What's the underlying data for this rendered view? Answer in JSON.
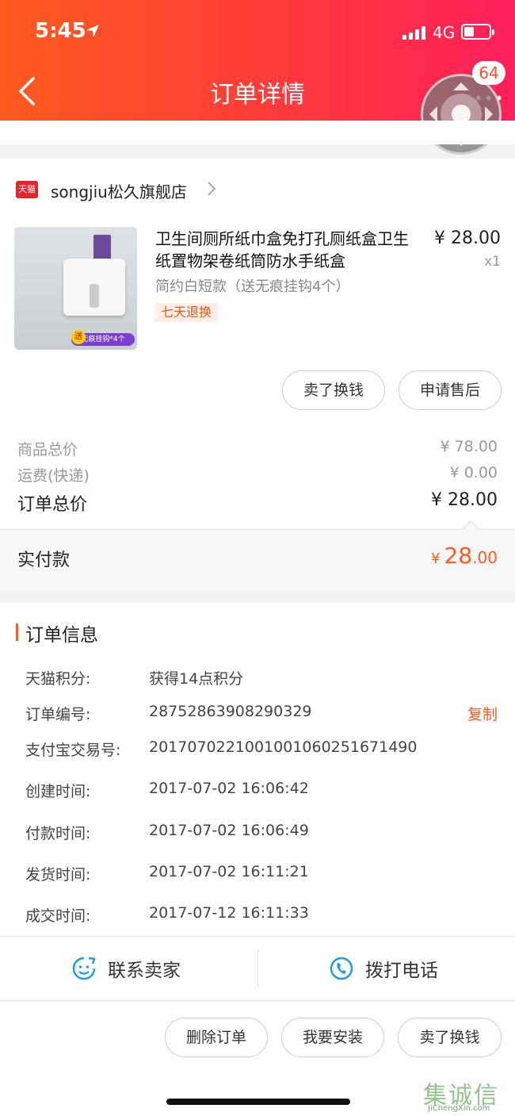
{
  "status_bar": {
    "time": "5:45",
    "network": "4G"
  },
  "header": {
    "title": "订单详情",
    "badge_count": "64"
  },
  "store": {
    "logo_text": "天猫",
    "name": "songjiu松久旗舰店"
  },
  "product": {
    "title": "卫生间厕所纸巾盒免打孔厕纸盒卫生纸置物架卷纸筒防水手纸盒",
    "variant": "简约白短款（送无痕挂钩4个）",
    "tag": "七天退换",
    "price": "¥ 28.00",
    "quantity": "x1",
    "image_send": "送",
    "image_tag": "无痕挂钩*4个"
  },
  "item_actions": {
    "sell": "卖了换钱",
    "after_sale": "申请售后"
  },
  "summary": {
    "goods_label": "商品总价",
    "goods_value": "¥ 78.00",
    "shipping_label": "运费(快递)",
    "shipping_value": "¥ 0.00",
    "total_label": "订单总价",
    "total_value": "¥ 28.00"
  },
  "paid": {
    "label": "实付款",
    "currency": "¥",
    "integer": "28",
    "decimal": ".00"
  },
  "order_info": {
    "title": "订单信息",
    "copy": "复制",
    "rows": [
      {
        "label": "天猫积分:",
        "value": "获得14点积分"
      },
      {
        "label": "订单编号:",
        "value": "28752863908290329"
      },
      {
        "label": "支付宝交易号:",
        "value": "2017070221001001060251671490"
      },
      {
        "label": "创建时间:",
        "value": "2017-07-02 16:06:42"
      },
      {
        "label": "付款时间:",
        "value": "2017-07-02 16:06:49"
      },
      {
        "label": "发货时间:",
        "value": "2017-07-02 16:11:21"
      },
      {
        "label": "成交时间:",
        "value": "2017-07-12 16:11:33"
      }
    ]
  },
  "contact": {
    "seller": "联系卖家",
    "call": "拨打电话"
  },
  "bottom_actions": {
    "delete": "删除订单",
    "install": "我要安装",
    "sell": "卖了换钱"
  },
  "watermark": {
    "chars": "集诚信",
    "url": "JiChengXin.com"
  },
  "colors": {
    "accent": "#ff5a1f",
    "header_start": "#ff5a1f",
    "header_end": "#ff1f5c",
    "contact_icon": "#1e9ee8"
  }
}
